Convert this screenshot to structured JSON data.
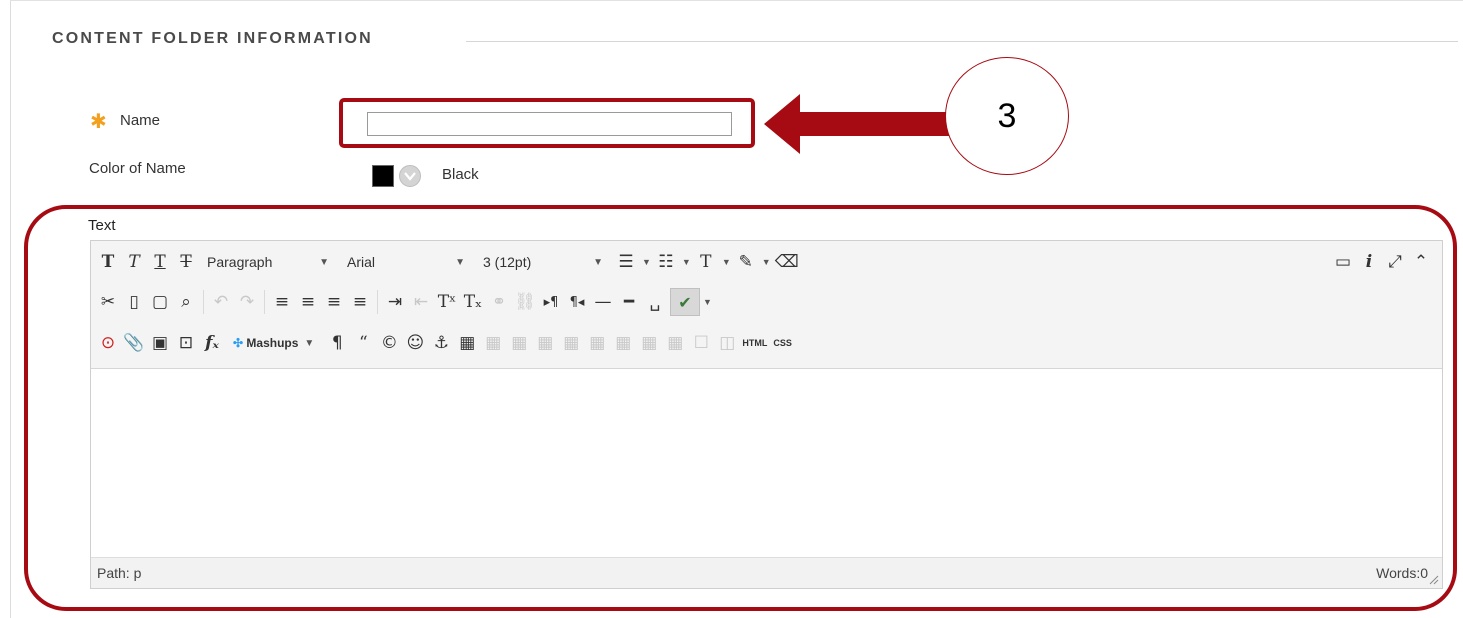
{
  "section": {
    "title": "CONTENT FOLDER INFORMATION"
  },
  "form": {
    "name_label": "Name",
    "name_value": "",
    "color_label": "Color of Name",
    "color_value": "Black",
    "text_label": "Text"
  },
  "editor": {
    "paragraph": "Paragraph",
    "font": "Arial",
    "size": "3 (12pt)",
    "mashups": "Mashups",
    "html": "HTML",
    "css": "CSS",
    "path": "Path: p",
    "words": "Words:0"
  },
  "annotation": {
    "step": "3"
  },
  "colors": {
    "accent": "#a60a12",
    "required": "#f2a01e"
  }
}
